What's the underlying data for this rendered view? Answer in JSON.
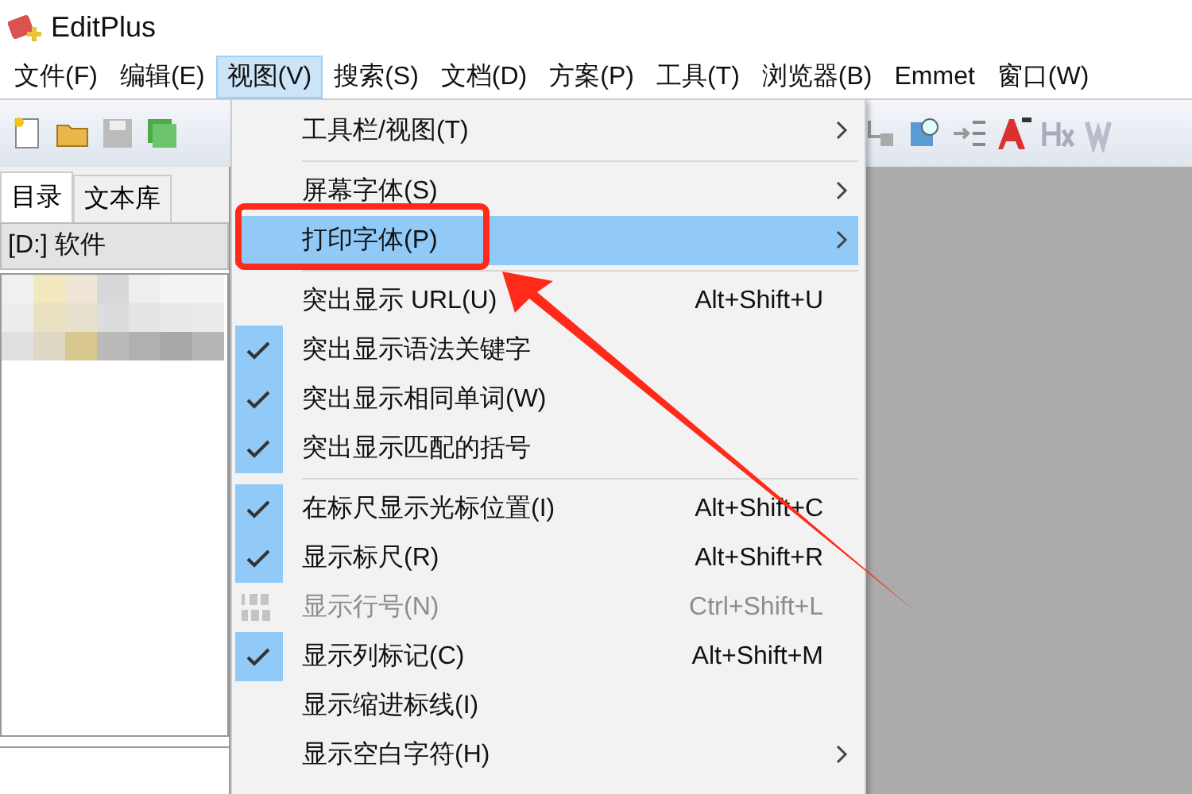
{
  "window": {
    "title": "EditPlus"
  },
  "menu_bar": [
    {
      "label": "文件(F)",
      "selected": false
    },
    {
      "label": "编辑(E)",
      "selected": false
    },
    {
      "label": "视图(V)",
      "selected": true
    },
    {
      "label": "搜索(S)",
      "selected": false
    },
    {
      "label": "文档(D)",
      "selected": false
    },
    {
      "label": "方案(P)",
      "selected": false
    },
    {
      "label": "工具(T)",
      "selected": false
    },
    {
      "label": "浏览器(B)",
      "selected": false
    },
    {
      "label": "Emmet",
      "selected": false
    },
    {
      "label": "窗口(W)",
      "selected": false
    }
  ],
  "sidebar": {
    "tabs": [
      {
        "label": "目录",
        "selected": true
      },
      {
        "label": "文本库",
        "selected": false
      }
    ],
    "path": "[D:] 软件"
  },
  "view_menu": [
    {
      "kind": "item",
      "label": "工具栏/视图(T)",
      "submenu": true,
      "selected": false,
      "checked": false,
      "disabled": false
    },
    {
      "kind": "separator"
    },
    {
      "kind": "item",
      "label": "屏幕字体(S)",
      "submenu": true,
      "selected": false,
      "checked": false,
      "disabled": false
    },
    {
      "kind": "item",
      "label": "打印字体(P)",
      "submenu": true,
      "selected": true,
      "checked": false,
      "disabled": false
    },
    {
      "kind": "separator"
    },
    {
      "kind": "item",
      "label": "突出显示 URL(U)",
      "shortcut": "Alt+Shift+U",
      "selected": false,
      "checked": false,
      "disabled": false
    },
    {
      "kind": "item",
      "label": "突出显示语法关键字",
      "selected": false,
      "checked": true,
      "disabled": false
    },
    {
      "kind": "item",
      "label": "突出显示相同单词(W)",
      "selected": false,
      "checked": true,
      "disabled": false
    },
    {
      "kind": "item",
      "label": "突出显示匹配的括号",
      "selected": false,
      "checked": true,
      "disabled": false
    },
    {
      "kind": "separator"
    },
    {
      "kind": "item",
      "label": "在标尺显示光标位置(I)",
      "shortcut": "Alt+Shift+C",
      "selected": false,
      "checked": true,
      "disabled": false
    },
    {
      "kind": "item",
      "label": "显示标尺(R)",
      "shortcut": "Alt+Shift+R",
      "selected": false,
      "checked": true,
      "disabled": false
    },
    {
      "kind": "numbered-item",
      "label": "显示行号(N)",
      "shortcut": "Ctrl+Shift+L",
      "selected": false,
      "checked": false,
      "disabled": true
    },
    {
      "kind": "item",
      "label": "显示列标记(C)",
      "shortcut": "Alt+Shift+M",
      "selected": false,
      "checked": true,
      "disabled": false
    },
    {
      "kind": "item",
      "label": "显示缩进标线(I)",
      "selected": false,
      "checked": false,
      "disabled": false
    },
    {
      "kind": "item",
      "label": "显示空白字符(H)",
      "submenu": true,
      "selected": false,
      "checked": false,
      "disabled": false
    }
  ]
}
